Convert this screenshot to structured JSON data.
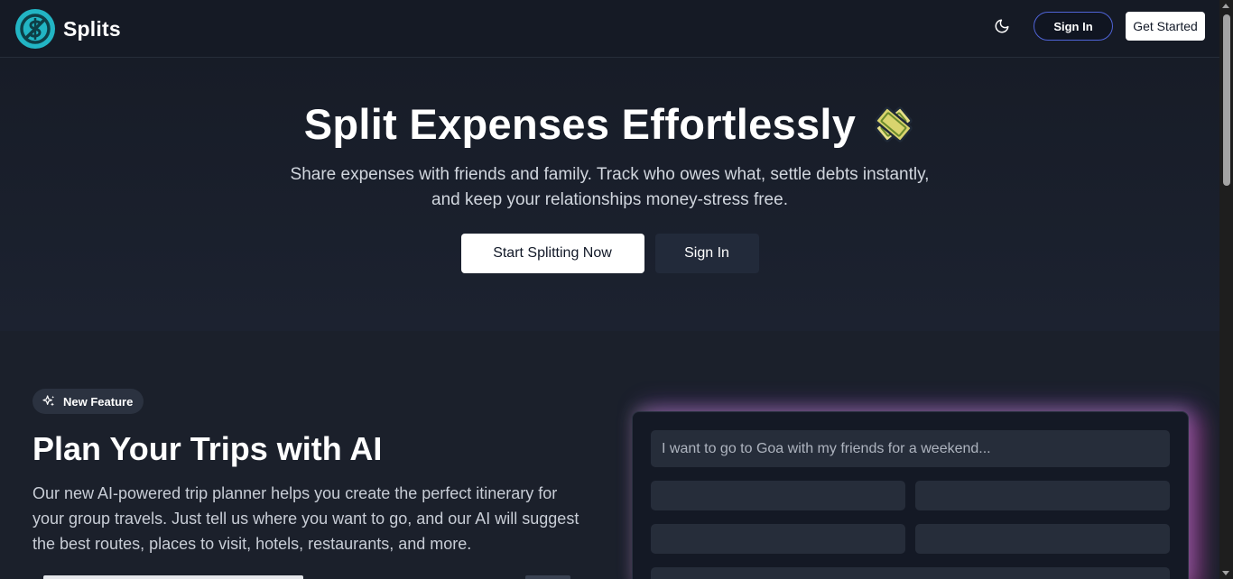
{
  "brand": {
    "name": "Splits",
    "logo_color": "#22b5c4",
    "logo_icon": "dollar-slash-icon"
  },
  "nav": {
    "theme_icon": "moon-icon",
    "sign_in_label": "Sign In",
    "get_started_label": "Get Started"
  },
  "hero": {
    "title": "Split Expenses Effortlessly",
    "title_icon": "money-emoji-icon",
    "subtitle_line1": "Share expenses with friends and family. Track who owes what, settle debts instantly,",
    "subtitle_line2": "and keep your relationships money-stress free.",
    "primary_button": "Start Splitting Now",
    "secondary_button": "Sign In"
  },
  "feature": {
    "badge_icon": "sparkles-icon",
    "badge_label": "New Feature",
    "title": "Plan Your Trips with AI",
    "desc_line1": "Our new AI-powered trip planner helps you create the perfect itinerary for",
    "desc_line2": "your group travels. Just tell us where you want to go, and our AI will suggest",
    "desc_line3": "the best routes, places to visit, hotels, restaurants, and more."
  },
  "planner": {
    "placeholder": "I want to go to Goa with my friends for a weekend..."
  },
  "colors": {
    "accent_border": "#4f63d6",
    "background": "#1a1f2b",
    "glow_purple": "#a855f7",
    "glow_pink": "#ec4899"
  }
}
